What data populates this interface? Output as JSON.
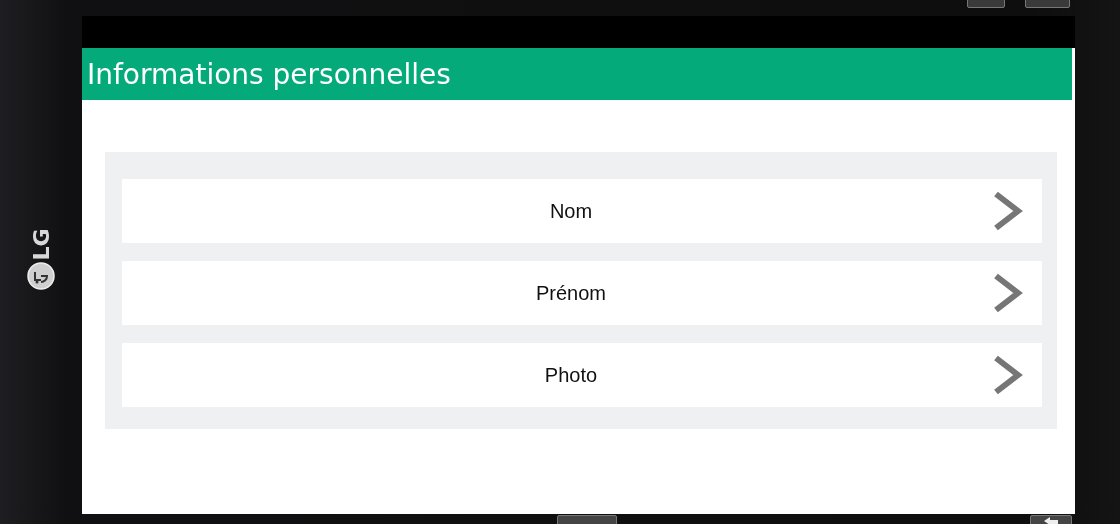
{
  "device": {
    "brand": "LG"
  },
  "header": {
    "title": "Informations personnelles"
  },
  "items": [
    {
      "label": "Nom"
    },
    {
      "label": "Prénom"
    },
    {
      "label": "Photo"
    }
  ]
}
